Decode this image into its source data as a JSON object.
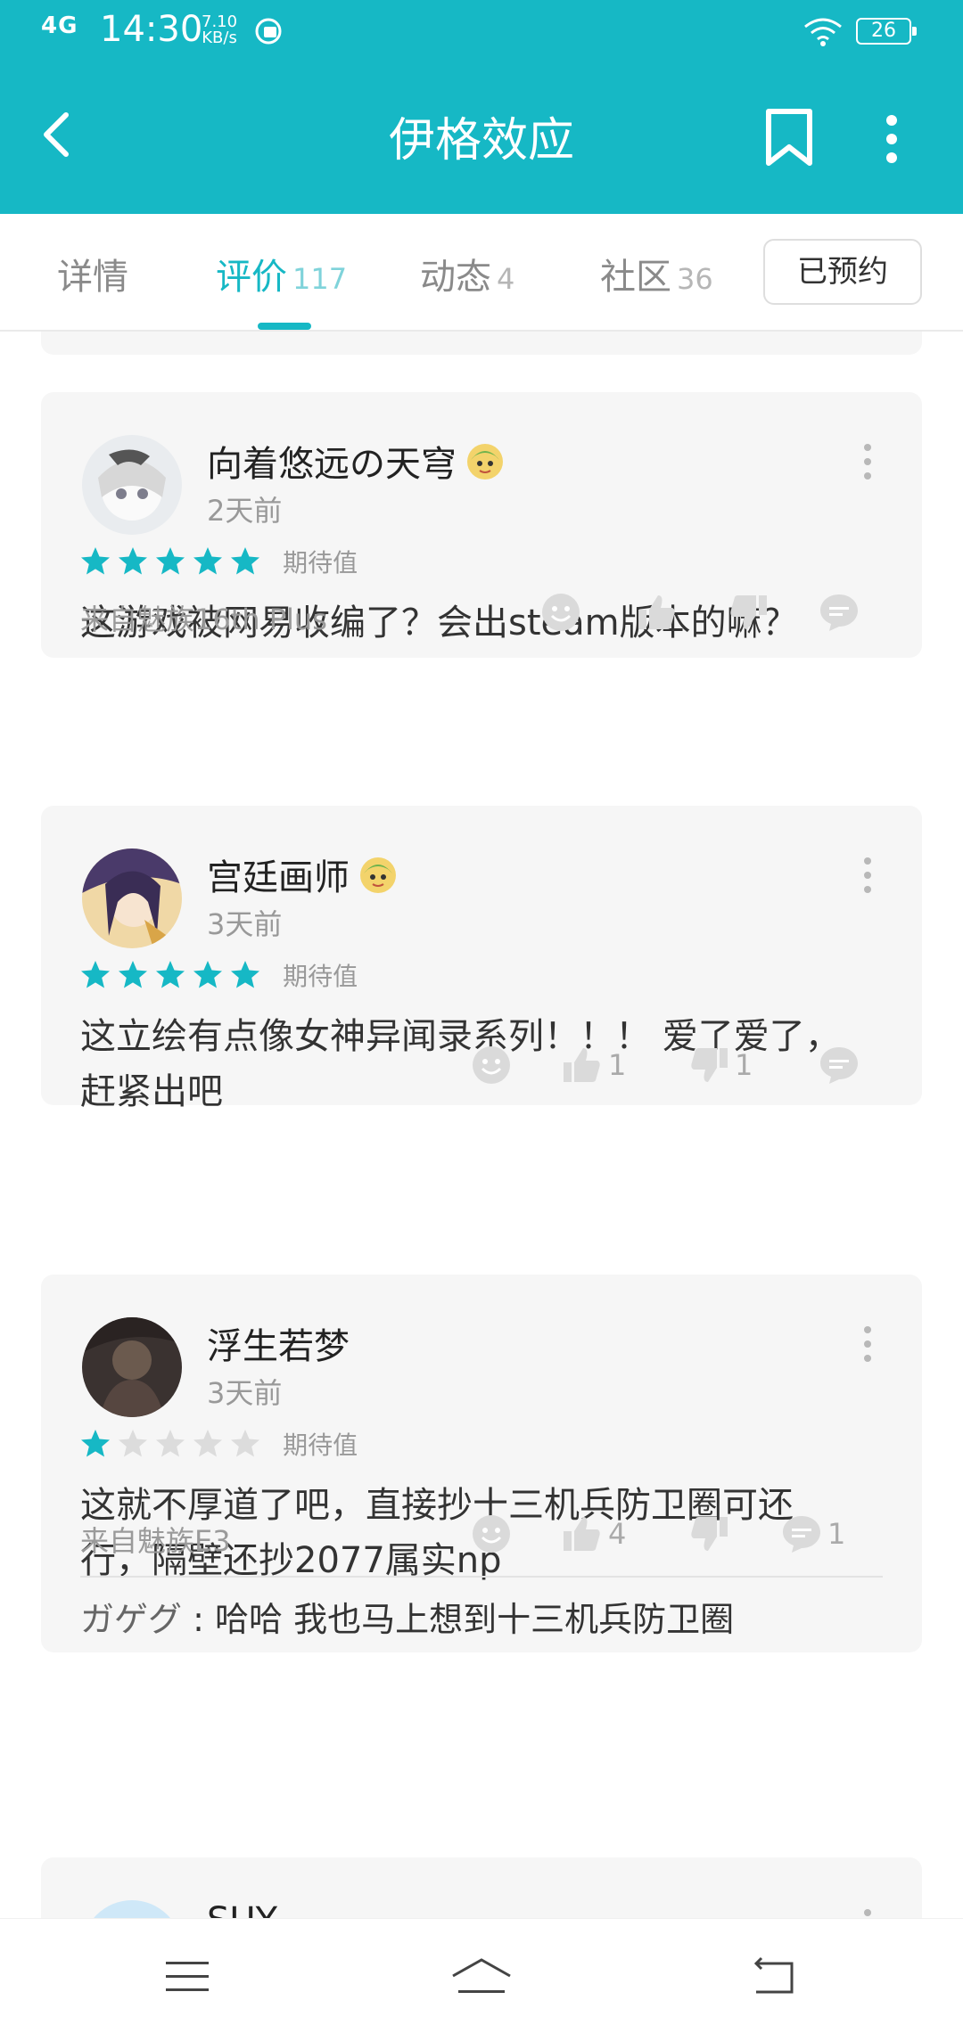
{
  "status_bar": {
    "network": "4G",
    "time": "14:30",
    "speed_value": "7.10",
    "speed_unit": "KB/s",
    "battery": "26"
  },
  "header": {
    "title": "伊格效应"
  },
  "tabs": [
    {
      "label": "详情",
      "count": ""
    },
    {
      "label": "评价",
      "count": "117"
    },
    {
      "label": "动态",
      "count": "4"
    },
    {
      "label": "社区",
      "count": "36"
    }
  ],
  "active_tab": 1,
  "reserve_button": "已预约",
  "colors": {
    "accent": "#16b8c5",
    "card_bg": "#f6f6f6",
    "star_empty": "#dcdcdc"
  },
  "reviews": [
    {
      "user": "向着悠远の天穹",
      "time": "2天前",
      "rating": 5,
      "rating_label": "期待值",
      "text": "这游戏被网易收编了？会出steam版本的嘛？",
      "device": "来自魅族16th Plus",
      "likes": "",
      "dislikes": "",
      "comments": ""
    },
    {
      "user": "宫廷画师",
      "time": "3天前",
      "rating": 5,
      "rating_label": "期待值",
      "text_line1": "这立绘有点像女神异闻录系列！！！ 爱了爱了，",
      "text_line2": "赶紧出吧",
      "device": "",
      "likes": "1",
      "dislikes": "1",
      "comments": ""
    },
    {
      "user": "浮生若梦",
      "time": "3天前",
      "rating": 1,
      "rating_label": "期待值",
      "text_line1": "这就不厚道了吧，直接抄十三机兵防卫圈可还",
      "text_line2": "行，隔壁还抄2077属实np",
      "device": "来自魅族E3",
      "likes": "4",
      "dislikes": "",
      "comments": "1",
      "reply_user": "ガゲグ",
      "reply_sep": " : ",
      "reply_text": "哈哈 我也马上想到十三机兵防卫圈"
    },
    {
      "user": "SUY"
    }
  ]
}
